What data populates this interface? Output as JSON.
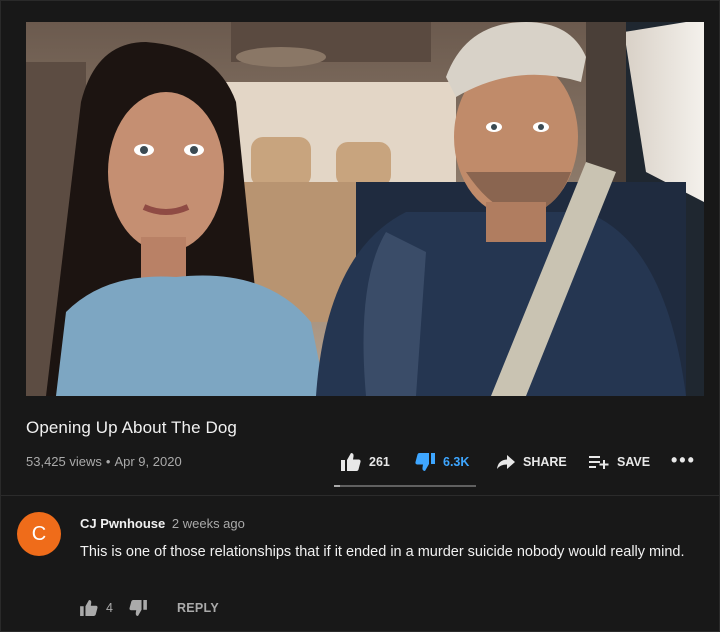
{
  "video": {
    "title": "Opening Up About The Dog",
    "views": "53,425 views",
    "date": "Apr 9, 2020",
    "separator": "•"
  },
  "actions": {
    "like_icon": "thumbs-up-icon",
    "likes": "261",
    "dislike_icon": "thumbs-down-icon",
    "dislikes": "6.3K",
    "dislike_active_color": "#3ea6ff",
    "share_icon": "share-arrow-icon",
    "share_label": "SHARE",
    "save_icon": "playlist-add-icon",
    "save_label": "SAVE",
    "more_icon": "more-horizontal-icon",
    "more_label": "•••",
    "like_ratio": 0.04
  },
  "comment": {
    "avatar_letter": "C",
    "avatar_color": "#ef6c1a",
    "author": "CJ Pwnhouse",
    "time": "2 weeks ago",
    "text": "This is one of those relationships that if it ended in a murder suicide nobody would really mind.",
    "likes": "4",
    "reply_label": "REPLY"
  }
}
